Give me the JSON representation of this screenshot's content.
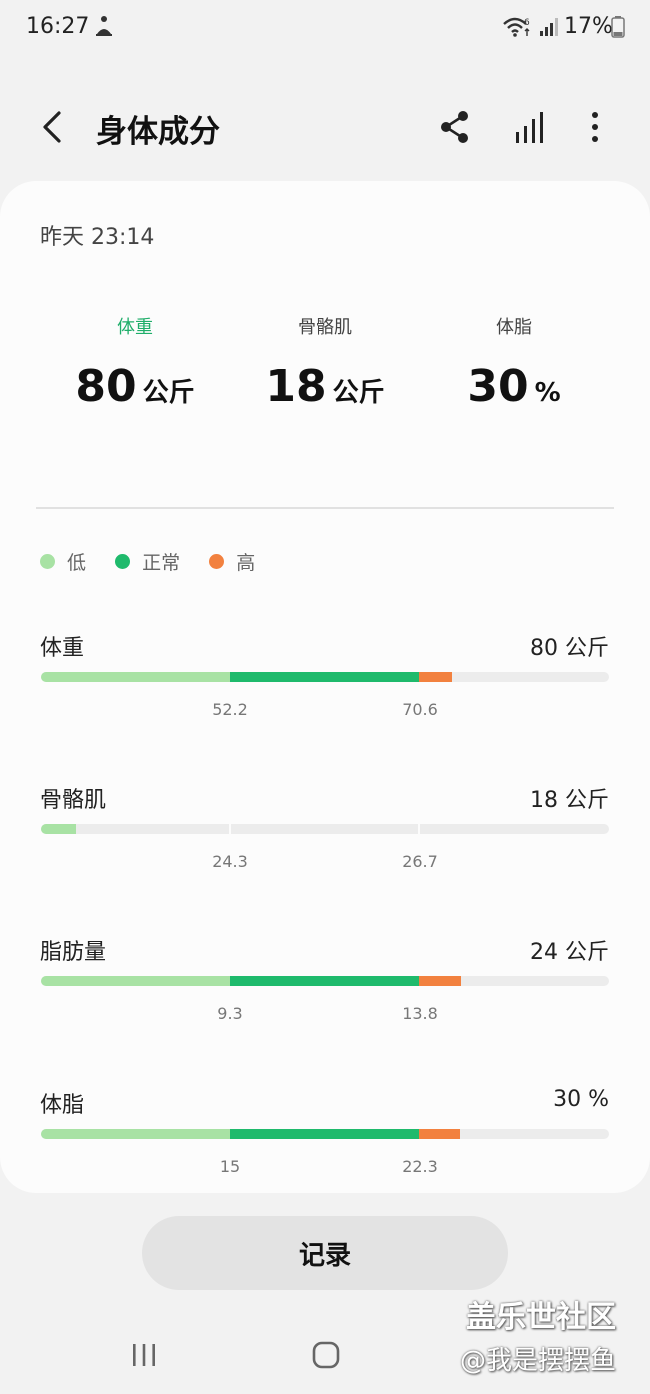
{
  "status_bar": {
    "time": "16:27",
    "battery_pct": "17%",
    "wifi_badge": "6"
  },
  "app_bar": {
    "title": "身体成分"
  },
  "card": {
    "timestamp": "昨天 23:14",
    "summary": [
      {
        "label": "体重",
        "value": "80",
        "unit": "公斤",
        "active": true
      },
      {
        "label": "骨骼肌",
        "value": "18",
        "unit": "公斤",
        "active": false
      },
      {
        "label": "体脂",
        "value": "30",
        "unit": "%",
        "active": false
      }
    ],
    "legend": [
      {
        "label": "低",
        "color": "#a8e2a4"
      },
      {
        "label": "正常",
        "color": "#1fba6c"
      },
      {
        "label": "高",
        "color": "#f2813f"
      }
    ],
    "metrics": [
      {
        "label": "体重",
        "value": "80 公斤",
        "low": "52.2",
        "high": "70.6",
        "level": "high"
      },
      {
        "label": "骨骼肌",
        "value": "18 公斤",
        "low": "24.3",
        "high": "26.7",
        "level": "low"
      },
      {
        "label": "脂肪量",
        "value": "24 公斤",
        "low": "9.3",
        "high": "13.8",
        "level": "high"
      },
      {
        "label": "体脂",
        "value": "30 %",
        "low": "15",
        "high": "22.3",
        "level": "high"
      }
    ]
  },
  "record_button": "记录",
  "watermark": {
    "line1": "盖乐世社区",
    "line2": "@我是摆摆鱼"
  },
  "colors": {
    "low": "#a8e2a4",
    "normal": "#1fba6c",
    "high": "#f2813f",
    "accent": "#1fae6a"
  }
}
